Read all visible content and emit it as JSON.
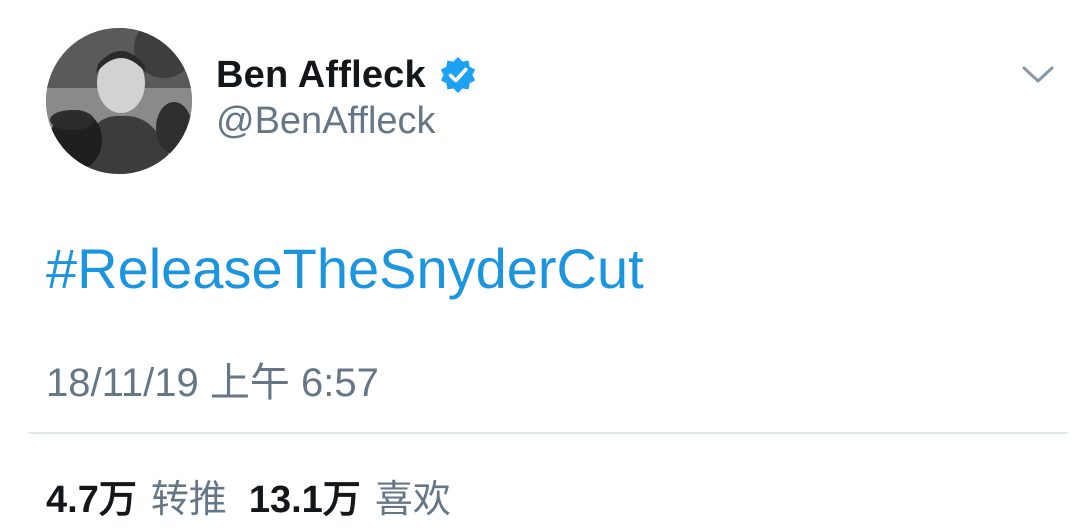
{
  "user": {
    "display_name": "Ben Affleck",
    "handle": "@BenAffleck",
    "verified": true
  },
  "tweet": {
    "text": "#ReleaseTheSnyderCut",
    "timestamp": "18/11/19 上午 6:57"
  },
  "stats": {
    "retweets": {
      "count": "4.7万",
      "label": "转推"
    },
    "likes": {
      "count": "13.1万",
      "label": "喜欢"
    }
  },
  "icons": {
    "verified": "verified-badge-icon",
    "menu": "chevron-down-icon"
  },
  "colors": {
    "link": "#1b95e0",
    "verified": "#1da1f2",
    "secondary_text": "#657786",
    "divider": "#e1e8ed"
  }
}
